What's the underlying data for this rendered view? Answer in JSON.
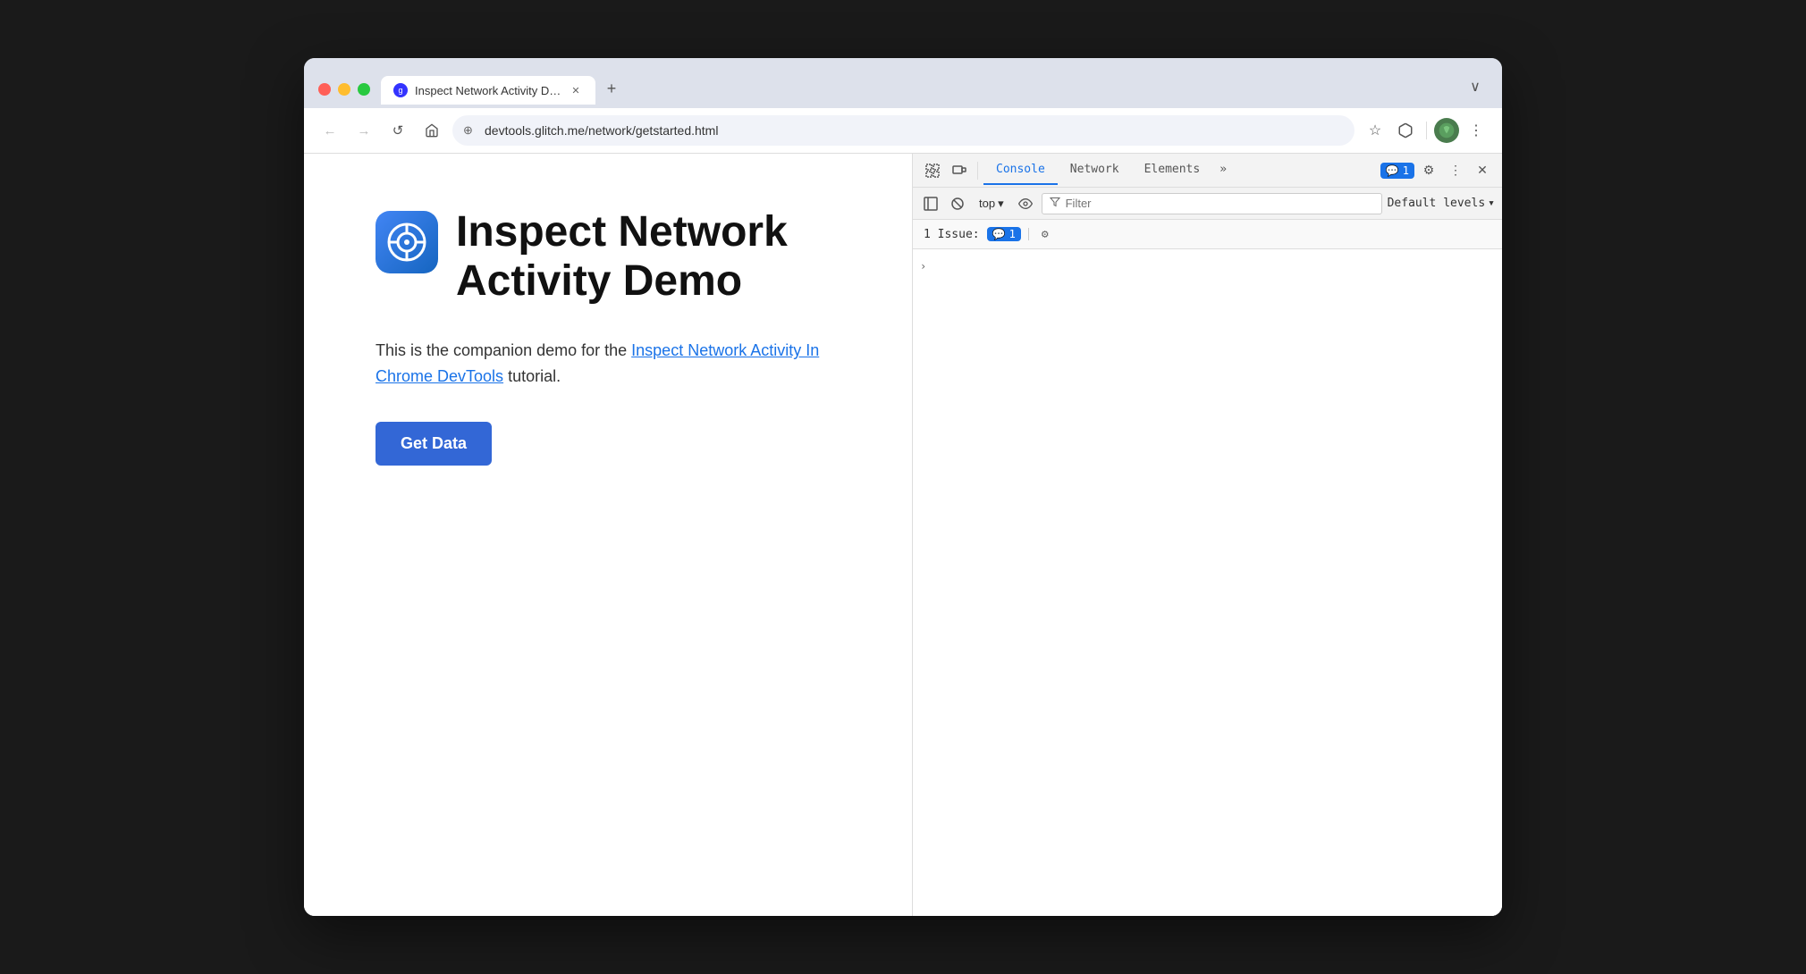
{
  "window": {
    "controls": {
      "close_label": "",
      "minimize_label": "",
      "maximize_label": ""
    }
  },
  "tab": {
    "title": "Inspect Network Activity Dem",
    "url": "devtools.glitch.me/network/getstarted.html"
  },
  "nav": {
    "back_label": "←",
    "forward_label": "→",
    "reload_label": "↺",
    "home_label": "⌂",
    "address": "devtools.glitch.me/network/getstarted.html",
    "bookmark_label": "☆",
    "extensions_label": "🧩",
    "menu_label": "⋮",
    "new_tab_label": "+",
    "window_menu_label": "∨"
  },
  "page": {
    "title": "Inspect Network Activity Demo",
    "description_prefix": "This is the companion demo for the ",
    "link_text": "Inspect Network Activity In Chrome DevTools",
    "description_suffix": " tutorial.",
    "get_data_label": "Get Data"
  },
  "devtools": {
    "toolbar": {
      "select_icon_label": "⠿",
      "device_icon_label": "▭",
      "separator": "",
      "dock_icon_label": "⊞",
      "clear_icon_label": "⊘"
    },
    "tabs": [
      {
        "label": "Console",
        "active": true
      },
      {
        "label": "Network",
        "active": false
      },
      {
        "label": "Elements",
        "active": false
      }
    ],
    "tabs_overflow_label": "»",
    "issue_badge_icon": "💬",
    "issue_badge_count": "1",
    "settings_label": "⚙",
    "more_label": "⋮",
    "close_label": "✕"
  },
  "console": {
    "sidebar_label": "⊟",
    "clear_label": "⊘",
    "top_label": "top",
    "eye_label": "👁",
    "filter_placeholder": "Filter",
    "default_levels_label": "Default levels",
    "chevron_down": "▾",
    "issues_label": "1 Issue:",
    "issues_badge_icon": "💬",
    "issues_badge_count": "1",
    "issues_settings_label": "⚙",
    "console_chevron": "›"
  },
  "colors": {
    "active_tab": "#1a73e8",
    "get_data_btn": "#3367d6",
    "page_link": "#1a73e8",
    "logo_bg": "#4285f4"
  }
}
